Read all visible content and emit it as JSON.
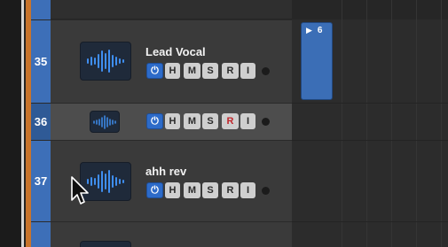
{
  "tracks": [
    {
      "number": "35",
      "name": "Lead Vocal",
      "selected": false,
      "record_armed": false
    },
    {
      "number": "36",
      "name": "",
      "selected": true,
      "record_armed": true
    },
    {
      "number": "37",
      "name": "ahh rev",
      "selected": false,
      "record_armed": false
    }
  ],
  "buttons": {
    "power": "⏻",
    "hide": "H",
    "mute": "M",
    "solo": "S",
    "record": "R",
    "input": "I"
  },
  "region": {
    "play_symbol": "▶",
    "label": "6"
  },
  "colors": {
    "track_blue": "#3d6fb8",
    "orange_strip": "#c8742c",
    "record_red": "#c0262b",
    "power_on": "#2d6bc9",
    "region_blue": "#3b6eb6"
  },
  "icons": [
    "waveform-icon",
    "power-icon",
    "mouse-cursor-icon"
  ]
}
